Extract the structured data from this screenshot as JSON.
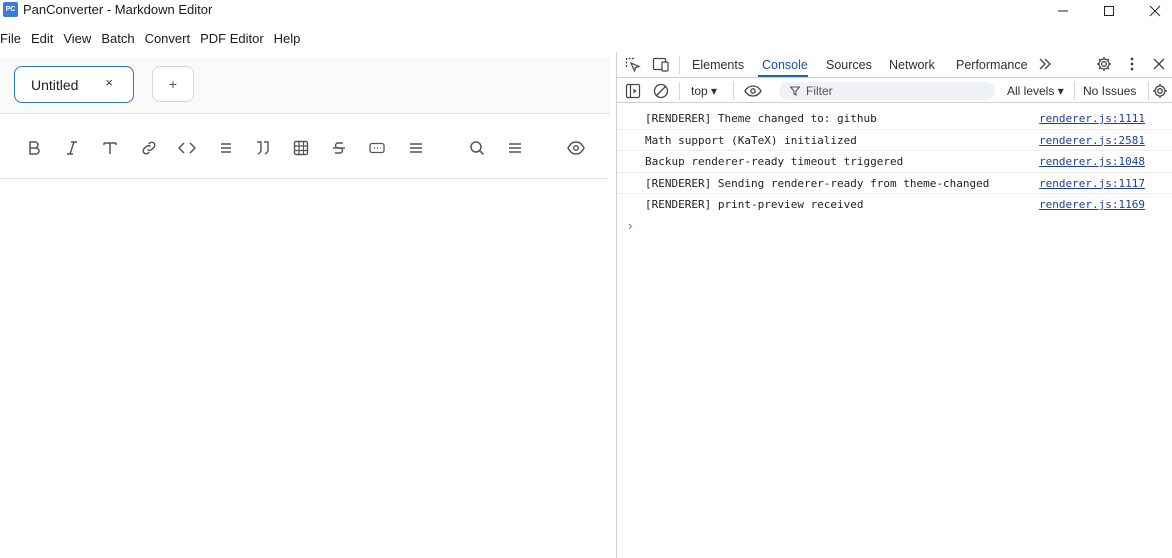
{
  "window": {
    "title": "PanConverter - Markdown Editor",
    "app_icon_text": "PC"
  },
  "menu": [
    "File",
    "Edit",
    "View",
    "Batch",
    "Convert",
    "PDF Editor",
    "Help"
  ],
  "editor": {
    "tab_label": "Untitled",
    "tab_close": "×",
    "add_tab": "+",
    "toolbar_icons": [
      "bold-icon",
      "italic-icon",
      "heading-icon",
      "link-icon",
      "code-icon",
      "list-icon",
      "quote-icon",
      "table-icon",
      "strikethrough-icon",
      "code-block-icon",
      "align-icon",
      "search-icon",
      "menu-icon",
      "preview-eye-icon"
    ]
  },
  "devtools": {
    "tabs": [
      "Elements",
      "Console",
      "Sources",
      "Network",
      "Performance"
    ],
    "active_tab": "Console",
    "context": "top",
    "filter_placeholder": "Filter",
    "levels": "All levels",
    "issues": "No Issues",
    "console": [
      {
        "message": "[RENDERER] Theme changed to: github",
        "source": "renderer.js:1111"
      },
      {
        "message": "Math support (KaTeX) initialized",
        "source": "renderer.js:2581"
      },
      {
        "message": "Backup renderer-ready timeout triggered",
        "source": "renderer.js:1048"
      },
      {
        "message": "[RENDERER] Sending renderer-ready from theme-changed",
        "source": "renderer.js:1117"
      },
      {
        "message": "[RENDERER] print-preview received",
        "source": "renderer.js:1169"
      }
    ],
    "prompt_symbol": "›"
  },
  "colors": {
    "accent": "#1a62d6",
    "link": "#1a3f9e",
    "app_icon": "#3c7bd9"
  }
}
